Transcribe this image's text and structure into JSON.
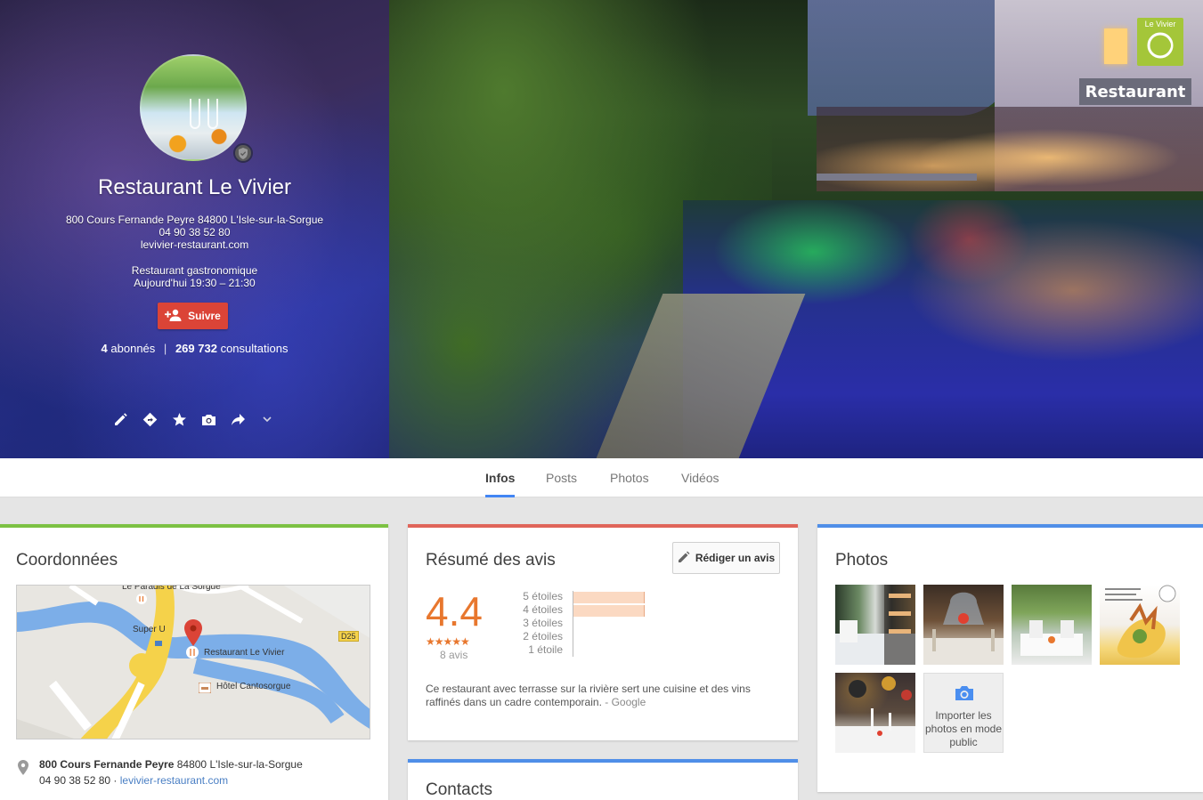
{
  "profile": {
    "name": "Restaurant Le Vivier",
    "address": "800 Cours Fernande Peyre 84800 L'Isle-sur-la-Sorgue",
    "phone": "04 90 38 52 80",
    "website": "levivier-restaurant.com",
    "category": "Restaurant gastronomique",
    "hours": "Aujourd'hui 19:30 – 21:30",
    "follow_label": "Suivre",
    "followers_count": "4",
    "followers_label": "abonnés",
    "stats_separator": "|",
    "views_count": "269 732",
    "views_label": "consultations"
  },
  "cover": {
    "sign_text": "Restaurant",
    "logo_text": "Le Vivier"
  },
  "tabs": [
    {
      "label": "Infos",
      "active": true
    },
    {
      "label": "Posts",
      "active": false
    },
    {
      "label": "Photos",
      "active": false
    },
    {
      "label": "Vidéos",
      "active": false
    }
  ],
  "coordonnees": {
    "title": "Coordonnées",
    "map_labels": {
      "paradis": "Le Paradis de La Sorgue",
      "superu": "Super U",
      "restaurant": "Restaurant Le Vivier",
      "hotel": "Hôtel Cantosorgue",
      "road": "D25"
    },
    "address_bold": "800 Cours Fernande Peyre",
    "address_rest": " 84800 L'Isle-sur-la-Sorgue",
    "phone": "04 90 38 52 80",
    "separator": " · ",
    "website": "levivier-restaurant.com"
  },
  "reviews": {
    "title": "Résumé des avis",
    "write_label": "Rédiger un avis",
    "rating": "4.4",
    "stars_glyphs": "★★★★★",
    "count_label": "8 avis",
    "distribution": [
      {
        "label": "5 étoiles",
        "share": 0.5
      },
      {
        "label": "4 étoiles",
        "share": 0.5
      },
      {
        "label": "3 étoiles",
        "share": 0
      },
      {
        "label": "2 étoiles",
        "share": 0
      },
      {
        "label": "1 étoile",
        "share": 0
      }
    ],
    "summary": "Ce restaurant avec terrasse sur la rivière sert une cuisine et des vins raffinés dans un cadre contemporain.",
    "summary_source": " - Google"
  },
  "contacts": {
    "title": "Contacts"
  },
  "photos": {
    "title": "Photos",
    "upload_label": "Importer les photos en mode public"
  },
  "colors": {
    "coordonnees_accent": "#7cc143",
    "reviews_accent": "#e0655a",
    "photos_accent": "#4f8ee8",
    "contacts_accent": "#4f8ee8",
    "follow_button": "#db4437",
    "rating": "#e8772e",
    "tab_indicator": "#4285f4"
  }
}
